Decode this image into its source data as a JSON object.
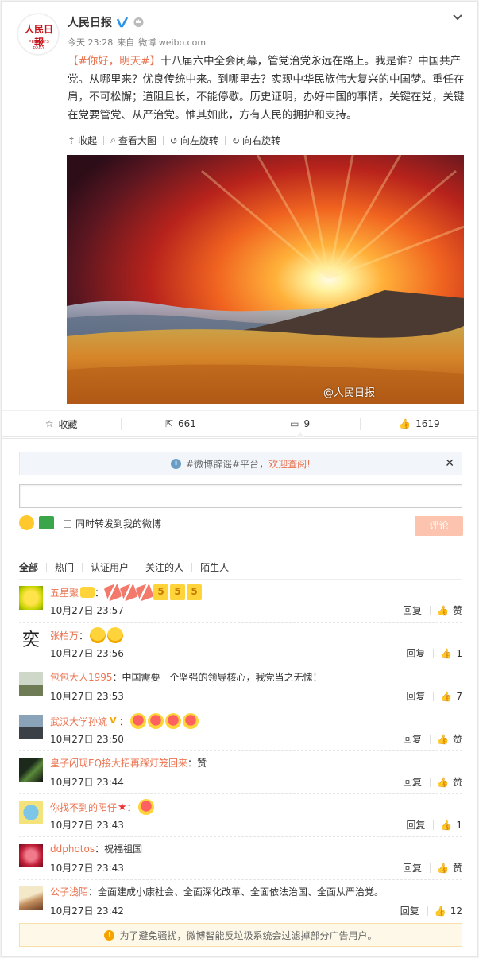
{
  "post": {
    "author": "人民日报",
    "logo_text": "人民日報",
    "logo_sub": "PEOPLE'S DAILY",
    "time": "今天 23:28",
    "source_prefix": "来自",
    "source": "微博 weibo.com",
    "hashtag": "【#你好，明天#】",
    "body": "十八届六中全会闭幕，管党治党永远在路上。我是谁？中国共产党。从哪里来？优良传统中来。到哪里去？实现中华民族伟大复兴的中国梦。重任在肩，不可松懈；道阻且长，不能停歇。历史证明，办好中国的事情，关键在党，关键在党要管党、从严治党。惟其如此，方有人民的拥护和支持。",
    "image_tools": [
      "收起",
      "查看大图",
      "向左旋转",
      "向右旋转"
    ],
    "watermark": "@人民日报"
  },
  "actions": {
    "favorite": "收藏",
    "repost": "661",
    "comment": "9",
    "like": "1619"
  },
  "comment_box": {
    "notice_pre": "#微博辟谣#平台，",
    "notice_link": "欢迎查阅!",
    "repost_label": "同时转发到我的微博",
    "submit": "评论"
  },
  "filters": [
    "全部",
    "热门",
    "认证用户",
    "关注的人",
    "陌生人"
  ],
  "comments": [
    {
      "name": "五星聚",
      "text": "",
      "time": "10月27日 23:57",
      "reply": "回复",
      "likes": "赞",
      "emo": "candles"
    },
    {
      "name": "张柏万",
      "text": "",
      "time": "10月27日 23:56",
      "reply": "回复",
      "likes": "1",
      "emo": "cry"
    },
    {
      "name": "包包大人1995",
      "text": "：中国需要一个坚强的领导核心，我党当之无愧！",
      "time": "10月27日 23:53",
      "reply": "回复",
      "likes": "7",
      "emo": ""
    },
    {
      "name": "武汉大学孙婉",
      "text": "",
      "time": "10月27日 23:50",
      "reply": "回复",
      "likes": "赞",
      "emo": "hearts4"
    },
    {
      "name": "皇子闪现EQ接大招再踩灯笼回来",
      "text": "：赞",
      "time": "10月27日 23:44",
      "reply": "回复",
      "likes": "赞",
      "emo": ""
    },
    {
      "name": "你找不到的阳仔",
      "text": "",
      "time": "10月27日 23:43",
      "reply": "回复",
      "likes": "1",
      "emo": "heart1"
    },
    {
      "name": "ddphotos",
      "text": "：祝福祖国",
      "time": "10月27日 23:43",
      "reply": "回复",
      "likes": "赞",
      "emo": ""
    },
    {
      "name": "公子浅陌",
      "text": "：全面建成小康社会、全面深化改革、全面依法治国、全面从严治党。",
      "time": "10月27日 23:42",
      "reply": "回复",
      "likes": "12",
      "emo": ""
    }
  ],
  "warning": "为了避免骚扰，微博智能反垃圾系统会过滤掉部分广告用户。",
  "colors": {
    "accent": "#eb7350",
    "submit_disabled": "#fcc3ae"
  }
}
